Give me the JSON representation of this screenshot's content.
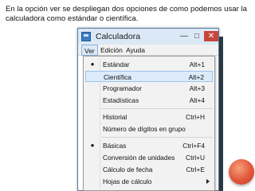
{
  "caption": "En la opción ver se despliegan dos opciones de como podemos usar la calculadora como estándar o científica.",
  "window": {
    "title": "Calculadora",
    "minimize_glyph": "—",
    "maximize_glyph": "□",
    "close_glyph": "✕"
  },
  "menubar": {
    "ver": "Ver",
    "edicion": "Edición",
    "ayuda": "Ayuda"
  },
  "dropdown": {
    "items": [
      {
        "label": "Estándar",
        "shortcut": "Alt+1",
        "bullet": "●"
      },
      {
        "label": "Científica",
        "shortcut": "Alt+2",
        "bullet": ""
      },
      {
        "label": "Programador",
        "shortcut": "Alt+3",
        "bullet": ""
      },
      {
        "label": "Estadísticas",
        "shortcut": "Alt+4",
        "bullet": ""
      },
      {
        "label": "Historial",
        "shortcut": "Ctrl+H",
        "bullet": ""
      },
      {
        "label": "Número de dígitos en grupo",
        "shortcut": "",
        "bullet": ""
      },
      {
        "label": "Básicas",
        "shortcut": "Ctrl+F4",
        "bullet": "●"
      },
      {
        "label": "Conversión de unidades",
        "shortcut": "Ctrl+U",
        "bullet": ""
      },
      {
        "label": "Cálculo de fecha",
        "shortcut": "Ctrl+E",
        "bullet": ""
      },
      {
        "label": "Hojas de cálculo",
        "shortcut": "",
        "bullet": ""
      }
    ]
  },
  "colors": {
    "highlight": "#dcebfa",
    "titlebar": "#dbe9f6",
    "close_button": "#c7463c",
    "decorative_ball": "#e2563b"
  }
}
